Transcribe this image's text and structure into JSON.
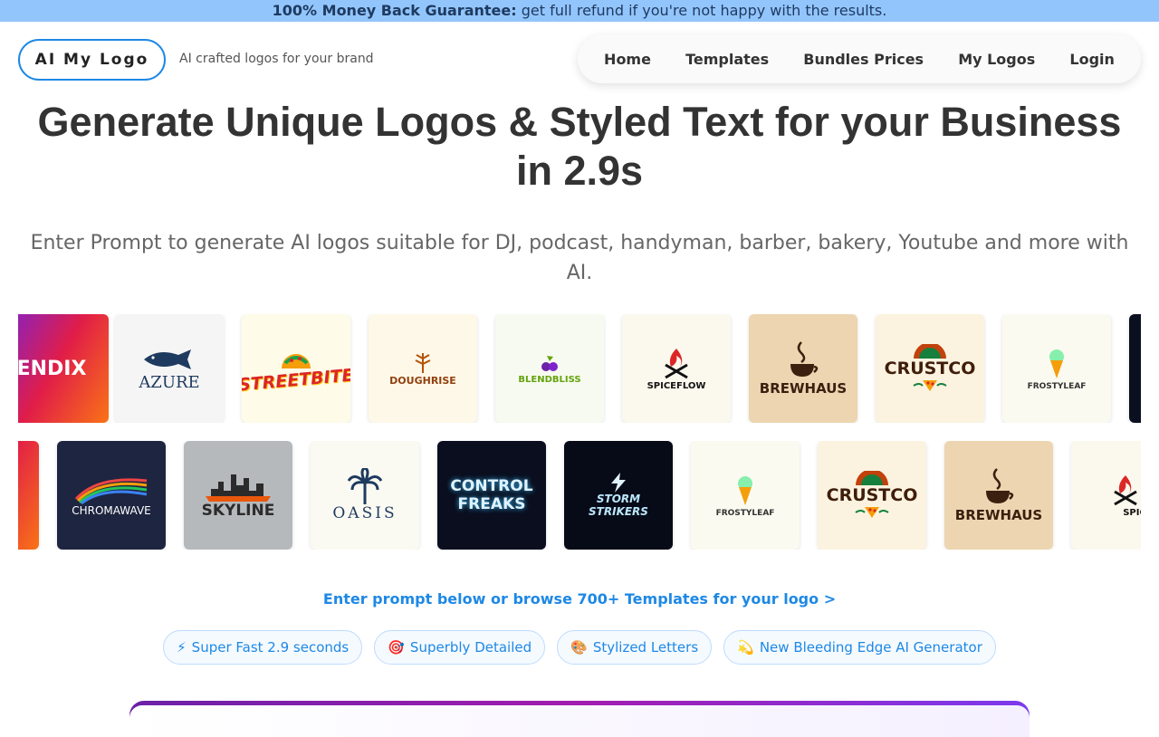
{
  "promo": {
    "bold": "100% Money Back Guarantee:",
    "text": " get full refund if you're not happy with the results."
  },
  "header": {
    "brand": "AI My Logo",
    "tagline": "AI crafted logos for your brand",
    "nav": [
      "Home",
      "Templates",
      "Bundles Prices",
      "My Logos",
      "Login"
    ]
  },
  "hero": {
    "title": "Generate Unique Logos & Styled Text for your Business in 2.9s",
    "subtitle": "Enter Prompt to generate AI logos suitable for DJ, podcast, handyman, barber, bakery, Youtube and more with AI."
  },
  "logos_row1": [
    "LENDIX",
    "AZURE",
    "STREETBITE",
    "DOUGHRISE",
    "BLENDBLISS",
    "SPICEFLOW",
    "BREWHAUS",
    "CRUSTCO",
    "FROSTYLEAF"
  ],
  "logos_row2": [
    "CHROMAWAVE",
    "SKYLINE",
    "OASIS",
    "CONTROL FREAKS",
    "STORM STRIKERS",
    "FROSTYLEAF",
    "CRUSTCO",
    "BREWHAUS",
    "SPICEFL"
  ],
  "cta": "Enter prompt below or browse 700+ Templates for your logo >",
  "chips": [
    {
      "icon": "⚡",
      "label": "Super Fast 2.9 seconds"
    },
    {
      "icon": "🎯",
      "label": "Superbly Detailed"
    },
    {
      "icon": "🎨",
      "label": "Stylized Letters"
    },
    {
      "icon": "💫",
      "label": "New Bleeding Edge AI Generator"
    }
  ],
  "colors": {
    "accent": "#1e88e5",
    "promo_bg": "#93c5fd"
  }
}
